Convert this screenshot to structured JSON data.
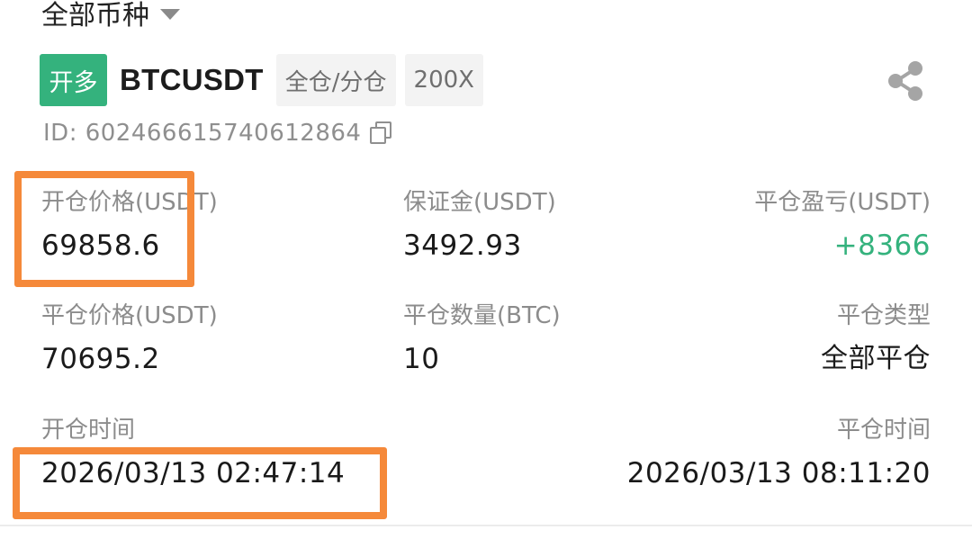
{
  "filter": {
    "label": "全部币种"
  },
  "position": {
    "side": "开多",
    "symbol": "BTCUSDT",
    "margin_mode": "全仓/分仓",
    "leverage": "200X",
    "id_text": "ID: 602466615740612864"
  },
  "fields": {
    "open_price": {
      "label": "开仓价格(USDT)",
      "value": "69858.6"
    },
    "margin": {
      "label": "保证金(USDT)",
      "value": "3492.93"
    },
    "close_pnl": {
      "label": "平仓盈亏(USDT)",
      "value": "+8366"
    },
    "close_price": {
      "label": "平仓价格(USDT)",
      "value": "70695.2"
    },
    "close_qty": {
      "label": "平仓数量(BTC)",
      "value": "10"
    },
    "close_type": {
      "label": "平仓类型",
      "value": "全部平仓"
    },
    "open_time": {
      "label": "开仓时间",
      "value": "2026/03/13 02:47:14"
    },
    "close_time": {
      "label": "平仓时间",
      "value": "2026/03/13 08:11:20"
    }
  },
  "colors": {
    "long": "#34b27d",
    "profit": "#34b27d",
    "highlight": "#f5893a"
  },
  "icons": {
    "filter_caret": "caret-down-icon",
    "share": "share-icon",
    "copy": "copy-icon"
  }
}
